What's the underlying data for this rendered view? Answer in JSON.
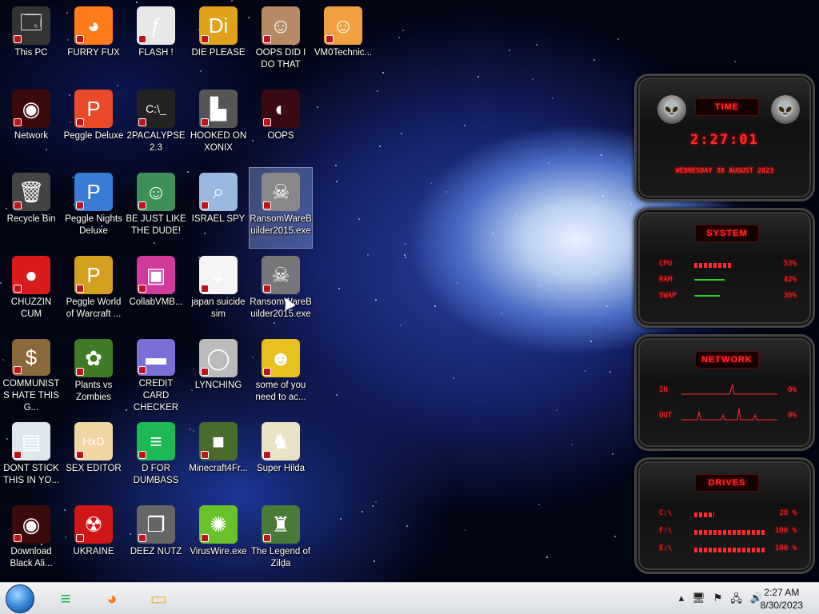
{
  "desktop": {
    "icons": [
      {
        "label": "This PC",
        "icon": "pc-icon",
        "glyph": "🗔",
        "bg": "#333"
      },
      {
        "label": "Network",
        "icon": "network-icon",
        "glyph": "◉",
        "bg": "#3b0a0a"
      },
      {
        "label": "Recycle Bin",
        "icon": "recycle-bin-icon",
        "glyph": "🗑",
        "bg": "#444"
      },
      {
        "label": "CHUZZIN CUM",
        "icon": "chuzzle-icon",
        "glyph": "●",
        "bg": "#d81b1b"
      },
      {
        "label": "COMMUNISTS HATE THIS G...",
        "icon": "money-bag-icon",
        "glyph": "$",
        "bg": "#8a6a3b"
      },
      {
        "label": "DONT STICK THIS IN YO...",
        "icon": "document-icon",
        "glyph": "▤",
        "bg": "#dfe7ee"
      },
      {
        "label": "Download Black Ali...",
        "icon": "alien-icon",
        "glyph": "◉",
        "bg": "#3b0a0a"
      },
      {
        "label": "FURRY FUX",
        "icon": "firefox-icon",
        "glyph": "◕",
        "bg": "#ff7a18"
      },
      {
        "label": "Peggle Deluxe",
        "icon": "peggle-icon",
        "glyph": "P",
        "bg": "#e84a2a"
      },
      {
        "label": "Peggle Nights Deluxe",
        "icon": "peggle-nights-icon",
        "glyph": "P",
        "bg": "#3a7bd5"
      },
      {
        "label": "Peggle World of Warcraft ...",
        "icon": "peggle-wow-icon",
        "glyph": "P",
        "bg": "#d4a020"
      },
      {
        "label": "Plants vs Zombies",
        "icon": "plants-icon",
        "glyph": "✿",
        "bg": "#3f7a24"
      },
      {
        "label": "SEX EDITOR",
        "icon": "hxd-icon",
        "glyph": "HxD",
        "bg": "#f0d6a2"
      },
      {
        "label": "UKRAINE",
        "icon": "radiation-icon",
        "glyph": "☢",
        "bg": "#d01616"
      },
      {
        "label": "FLASH !",
        "icon": "flash-icon",
        "glyph": "ƒ",
        "bg": "#e8e8e8"
      },
      {
        "label": "2PACALYPSE 2.3",
        "icon": "terminal-icon",
        "glyph": "C:\\_",
        "bg": "#222"
      },
      {
        "label": "BE JUST LIKE THE DUDE!",
        "icon": "dude-icon",
        "glyph": "☺",
        "bg": "#3f8f5a"
      },
      {
        "label": "CollabVMB...",
        "icon": "collabvm-icon",
        "glyph": "▣",
        "bg": "#d03a9a"
      },
      {
        "label": "CREDIT CARD CHECKER",
        "icon": "credit-card-icon",
        "glyph": "▬",
        "bg": "#7a6fd6"
      },
      {
        "label": "D FOR DUMBASS",
        "icon": "spotify-icon",
        "glyph": "≡",
        "bg": "#1db954"
      },
      {
        "label": "DEEZ NUTZ",
        "icon": "stack-icon",
        "glyph": "❐",
        "bg": "#666"
      },
      {
        "label": "DIE PLEASE",
        "icon": "die-icon",
        "glyph": "Di",
        "bg": "#e0a21a"
      },
      {
        "label": "HOOKED ON XONIX",
        "icon": "xonix-icon",
        "glyph": "▙",
        "bg": "#555"
      },
      {
        "label": "ISRAEL SPY",
        "icon": "spy-icon",
        "glyph": "⌕",
        "bg": "#9ab8e0"
      },
      {
        "label": "japan suicide sim",
        "icon": "sim-icon",
        "glyph": "⇣",
        "bg": "#f4f4f4"
      },
      {
        "label": "LYNCHING",
        "icon": "lynching-icon",
        "glyph": "◯",
        "bg": "#bbb"
      },
      {
        "label": "Minecraft4Fr...",
        "icon": "minecraft-icon",
        "glyph": "■",
        "bg": "#4b6b2c"
      },
      {
        "label": "VirusWire.exe",
        "icon": "limewire-icon",
        "glyph": "✺",
        "bg": "#6ac22b"
      },
      {
        "label": "OOPS DID I DO THAT",
        "icon": "portrait-icon",
        "glyph": "☺",
        "bg": "#b58a64"
      },
      {
        "label": "OOPS",
        "icon": "oops-icon",
        "glyph": "◐",
        "bg": "#3a0a14"
      },
      {
        "label": "RansomWareBuilder2015.exe",
        "icon": "skull-icon",
        "glyph": "☠",
        "bg": "#888",
        "selected": true
      },
      {
        "label": "RansomWareBuilder2015.exe",
        "icon": "skull-icon",
        "glyph": "☠",
        "bg": "#777"
      },
      {
        "label": "some of you need to ac...",
        "icon": "beaver-icon",
        "glyph": "☻",
        "bg": "#e8c020"
      },
      {
        "label": "Super Hilda",
        "icon": "hilda-icon",
        "glyph": "♞",
        "bg": "#e9e2c5"
      },
      {
        "label": "The Legend of Zilda",
        "icon": "zilda-icon",
        "glyph": "♜",
        "bg": "#4a7a3a"
      },
      {
        "label": "VM0Technic...",
        "icon": "technician-icon",
        "glyph": "☺",
        "bg": "#f0a040"
      }
    ]
  },
  "widget": {
    "time": {
      "title": "TIME",
      "clock": "2:27:01",
      "date": "WEDNESDAY 30 AUGUST 2023"
    },
    "system": {
      "title": "SYSTEM",
      "cpu_label": "CPU",
      "cpu_value": "53%",
      "cpu_pct": 53,
      "ram_label": "RAM",
      "ram_value": "42%",
      "ram_pct": 42,
      "swap_label": "SWAP",
      "swap_value": "36%",
      "swap_pct": 36
    },
    "network": {
      "title": "NETWORK",
      "in_label": "IN",
      "in_value": "0%",
      "out_label": "OUT",
      "out_value": "0%"
    },
    "drives": {
      "title": "DRIVES",
      "c_label": "C:\\",
      "c_value": "28 %",
      "c_pct": 28,
      "f_label": "F:\\",
      "f_value": "100 %",
      "f_pct": 100,
      "e_label": "E:\\",
      "e_value": "100 %",
      "e_pct": 100
    }
  },
  "taskbar": {
    "apps": [
      {
        "icon": "spotify-icon",
        "glyph": "≡",
        "color": "#1db954"
      },
      {
        "icon": "firefox-icon",
        "glyph": "◕",
        "color": "#ff7a18"
      },
      {
        "icon": "file-explorer-icon",
        "glyph": "▭",
        "color": "#e8b93a"
      }
    ],
    "time": "2:27 AM",
    "date": "8/30/2023"
  }
}
